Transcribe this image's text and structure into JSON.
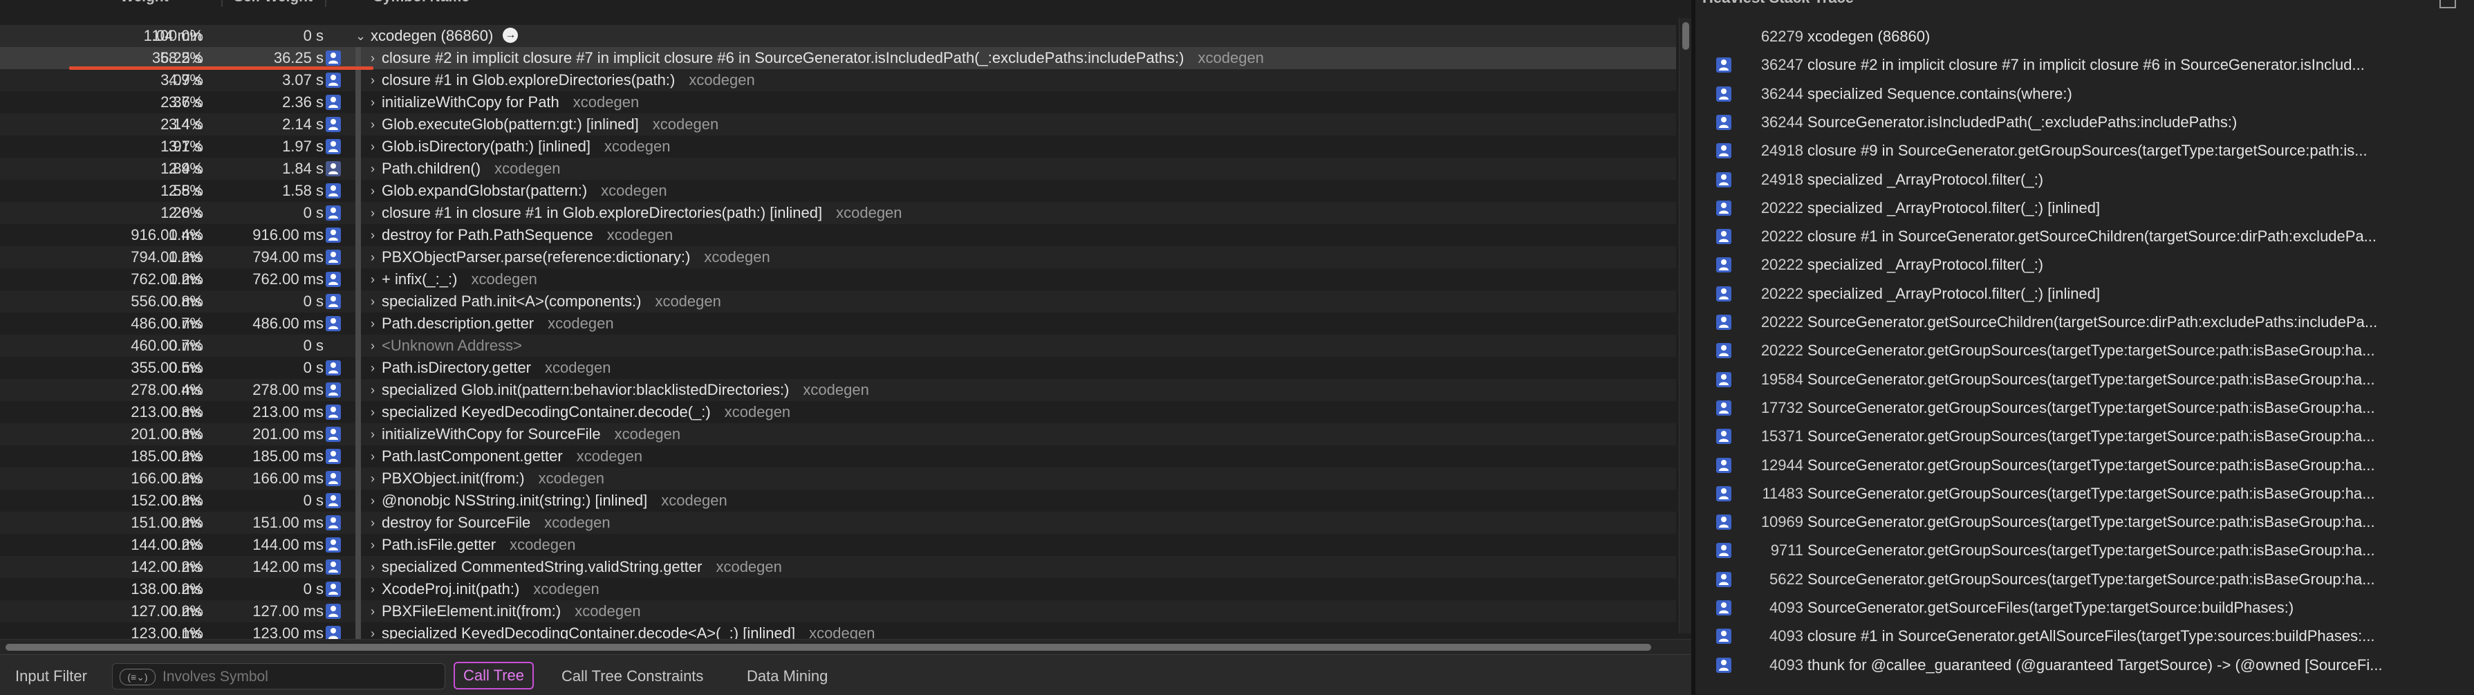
{
  "header": {
    "weight": "Weight",
    "self_weight": "Self Weight",
    "symbol_name": "Symbol Name"
  },
  "root": {
    "weight": "1.04 min",
    "pct": "100.0%",
    "self": "0 s",
    "symbol": "xcodegen (86860)"
  },
  "rows": [
    {
      "w": "36.25 s",
      "p": "58.2%",
      "s": "36.25 s",
      "sym": "closure #2 in implicit closure #7 in implicit closure #6 in SourceGenerator.isIncludedPath(_:excludePaths:includePaths:)",
      "lib": "xcodegen",
      "selected": true
    },
    {
      "w": "3.07 s",
      "p": "4.9%",
      "s": "3.07 s",
      "sym": "closure #1 in Glob.exploreDirectories(path:)",
      "lib": "xcodegen"
    },
    {
      "w": "2.36 s",
      "p": "3.7%",
      "s": "2.36 s",
      "sym": "initializeWithCopy for Path",
      "lib": "xcodegen"
    },
    {
      "w": "2.14 s",
      "p": "3.4%",
      "s": "2.14 s",
      "sym": "Glob.executeGlob(pattern:gt:) [inlined]",
      "lib": "xcodegen"
    },
    {
      "w": "1.97 s",
      "p": "3.1%",
      "s": "1.97 s",
      "sym": "Glob.isDirectory(path:) [inlined]",
      "lib": "xcodegen"
    },
    {
      "w": "1.84 s",
      "p": "2.9%",
      "s": "1.84 s",
      "sym": "Path.children()",
      "lib": "xcodegen",
      "gray": true
    },
    {
      "w": "1.58 s",
      "p": "2.5%",
      "s": "1.58 s",
      "sym": "Glob.expandGlobstar(pattern:)",
      "lib": "xcodegen"
    },
    {
      "w": "1.26 s",
      "p": "2.0%",
      "s": "0 s",
      "sym": "closure #1 in closure #1 in Glob.exploreDirectories(path:) [inlined]",
      "lib": "xcodegen"
    },
    {
      "w": "916.00 ms",
      "p": "1.4%",
      "s": "916.00 ms",
      "sym": "destroy for Path.PathSequence",
      "lib": "xcodegen"
    },
    {
      "w": "794.00 ms",
      "p": "1.2%",
      "s": "794.00 ms",
      "sym": "PBXObjectParser.parse(reference:dictionary:)",
      "lib": "xcodegen"
    },
    {
      "w": "762.00 ms",
      "p": "1.2%",
      "s": "762.00 ms",
      "sym": "+ infix(_:_:)",
      "lib": "xcodegen"
    },
    {
      "w": "556.00 ms",
      "p": "0.8%",
      "s": "0 s",
      "sym": "specialized Path.init<A>(components:)",
      "lib": "xcodegen"
    },
    {
      "w": "486.00 ms",
      "p": "0.7%",
      "s": "486.00 ms",
      "sym": "Path.description.getter",
      "lib": "xcodegen"
    },
    {
      "w": "460.00 ms",
      "p": "0.7%",
      "s": "0 s",
      "sym": "<Unknown Address>",
      "lib": "",
      "noicon": true,
      "dim": true
    },
    {
      "w": "355.00 ms",
      "p": "0.5%",
      "s": "0 s",
      "sym": "Path.isDirectory.getter",
      "lib": "xcodegen"
    },
    {
      "w": "278.00 ms",
      "p": "0.4%",
      "s": "278.00 ms",
      "sym": "specialized Glob.init(pattern:behavior:blacklistedDirectories:)",
      "lib": "xcodegen"
    },
    {
      "w": "213.00 ms",
      "p": "0.3%",
      "s": "213.00 ms",
      "sym": "specialized KeyedDecodingContainer.decode(_:)",
      "lib": "xcodegen"
    },
    {
      "w": "201.00 ms",
      "p": "0.3%",
      "s": "201.00 ms",
      "sym": "initializeWithCopy for SourceFile",
      "lib": "xcodegen"
    },
    {
      "w": "185.00 ms",
      "p": "0.2%",
      "s": "185.00 ms",
      "sym": "Path.lastComponent.getter",
      "lib": "xcodegen"
    },
    {
      "w": "166.00 ms",
      "p": "0.2%",
      "s": "166.00 ms",
      "sym": "PBXObject.init(from:)",
      "lib": "xcodegen"
    },
    {
      "w": "152.00 ms",
      "p": "0.2%",
      "s": "0 s",
      "sym": "@nonobjc NSString.init(string:) [inlined]",
      "lib": "xcodegen"
    },
    {
      "w": "151.00 ms",
      "p": "0.2%",
      "s": "151.00 ms",
      "sym": "destroy for SourceFile",
      "lib": "xcodegen"
    },
    {
      "w": "144.00 ms",
      "p": "0.2%",
      "s": "144.00 ms",
      "sym": "Path.isFile.getter",
      "lib": "xcodegen"
    },
    {
      "w": "142.00 ms",
      "p": "0.2%",
      "s": "142.00 ms",
      "sym": "specialized CommentedString.validString.getter",
      "lib": "xcodegen"
    },
    {
      "w": "138.00 ms",
      "p": "0.2%",
      "s": "0 s",
      "sym": "XcodeProj.init(path:)",
      "lib": "xcodegen"
    },
    {
      "w": "127.00 ms",
      "p": "0.2%",
      "s": "127.00 ms",
      "sym": "PBXFileElement.init(from:)",
      "lib": "xcodegen"
    },
    {
      "w": "123.00 ms",
      "p": "0.1%",
      "s": "123.00 ms",
      "sym": "specialized KeyedDecodingContainer.decode<A>(_:) [inlined]",
      "lib": "xcodegen"
    }
  ],
  "bottombar": {
    "input_filter": "Input Filter",
    "filter_pill": "(≡⌄)",
    "filter_placeholder": "Involves Symbol",
    "tabs": [
      "Call Tree",
      "Call Tree Constraints",
      "Data Mining"
    ]
  },
  "stack": {
    "title": "Heaviest Stack Trace",
    "items": [
      {
        "c": "62279",
        "n": "xcodegen (86860)",
        "noicon": true
      },
      {
        "c": "36247",
        "n": "closure #2 in implicit closure #7 in implicit closure #6 in SourceGenerator.isInclud..."
      },
      {
        "c": "36244",
        "n": "specialized Sequence.contains(where:)"
      },
      {
        "c": "36244",
        "n": "SourceGenerator.isIncludedPath(_:excludePaths:includePaths:)"
      },
      {
        "c": "24918",
        "n": "closure #9 in SourceGenerator.getGroupSources(targetType:targetSource:path:is..."
      },
      {
        "c": "24918",
        "n": "specialized _ArrayProtocol.filter(_:)"
      },
      {
        "c": "20222",
        "n": "specialized _ArrayProtocol.filter(_:) [inlined]"
      },
      {
        "c": "20222",
        "n": "closure #1 in SourceGenerator.getSourceChildren(targetSource:dirPath:excludePa..."
      },
      {
        "c": "20222",
        "n": "specialized _ArrayProtocol.filter(_:)"
      },
      {
        "c": "20222",
        "n": "specialized _ArrayProtocol.filter(_:) [inlined]"
      },
      {
        "c": "20222",
        "n": "SourceGenerator.getSourceChildren(targetSource:dirPath:excludePaths:includePa..."
      },
      {
        "c": "20222",
        "n": "SourceGenerator.getGroupSources(targetType:targetSource:path:isBaseGroup:ha..."
      },
      {
        "c": "19584",
        "n": "SourceGenerator.getGroupSources(targetType:targetSource:path:isBaseGroup:ha..."
      },
      {
        "c": "17732",
        "n": "SourceGenerator.getGroupSources(targetType:targetSource:path:isBaseGroup:ha..."
      },
      {
        "c": "15371",
        "n": "SourceGenerator.getGroupSources(targetType:targetSource:path:isBaseGroup:ha..."
      },
      {
        "c": "12944",
        "n": "SourceGenerator.getGroupSources(targetType:targetSource:path:isBaseGroup:ha..."
      },
      {
        "c": "11483",
        "n": "SourceGenerator.getGroupSources(targetType:targetSource:path:isBaseGroup:ha..."
      },
      {
        "c": "10969",
        "n": "SourceGenerator.getGroupSources(targetType:targetSource:path:isBaseGroup:ha..."
      },
      {
        "c": "9711",
        "n": "SourceGenerator.getGroupSources(targetType:targetSource:path:isBaseGroup:ha..."
      },
      {
        "c": "5622",
        "n": "SourceGenerator.getGroupSources(targetType:targetSource:path:isBaseGroup:ha..."
      },
      {
        "c": "4093",
        "n": "SourceGenerator.getSourceFiles(targetType:targetSource:buildPhases:)"
      },
      {
        "c": "4093",
        "n": "closure #1 in SourceGenerator.getAllSourceFiles(targetType:sources:buildPhases:..."
      },
      {
        "c": "4093",
        "n": "thunk for @callee_guaranteed (@guaranteed TargetSource) -> (@owned [SourceFi..."
      }
    ]
  },
  "colors": {
    "accent_tab": "#c94fd8",
    "highlight_line": "#e04a2f",
    "user_icon": "#3d63c9"
  }
}
